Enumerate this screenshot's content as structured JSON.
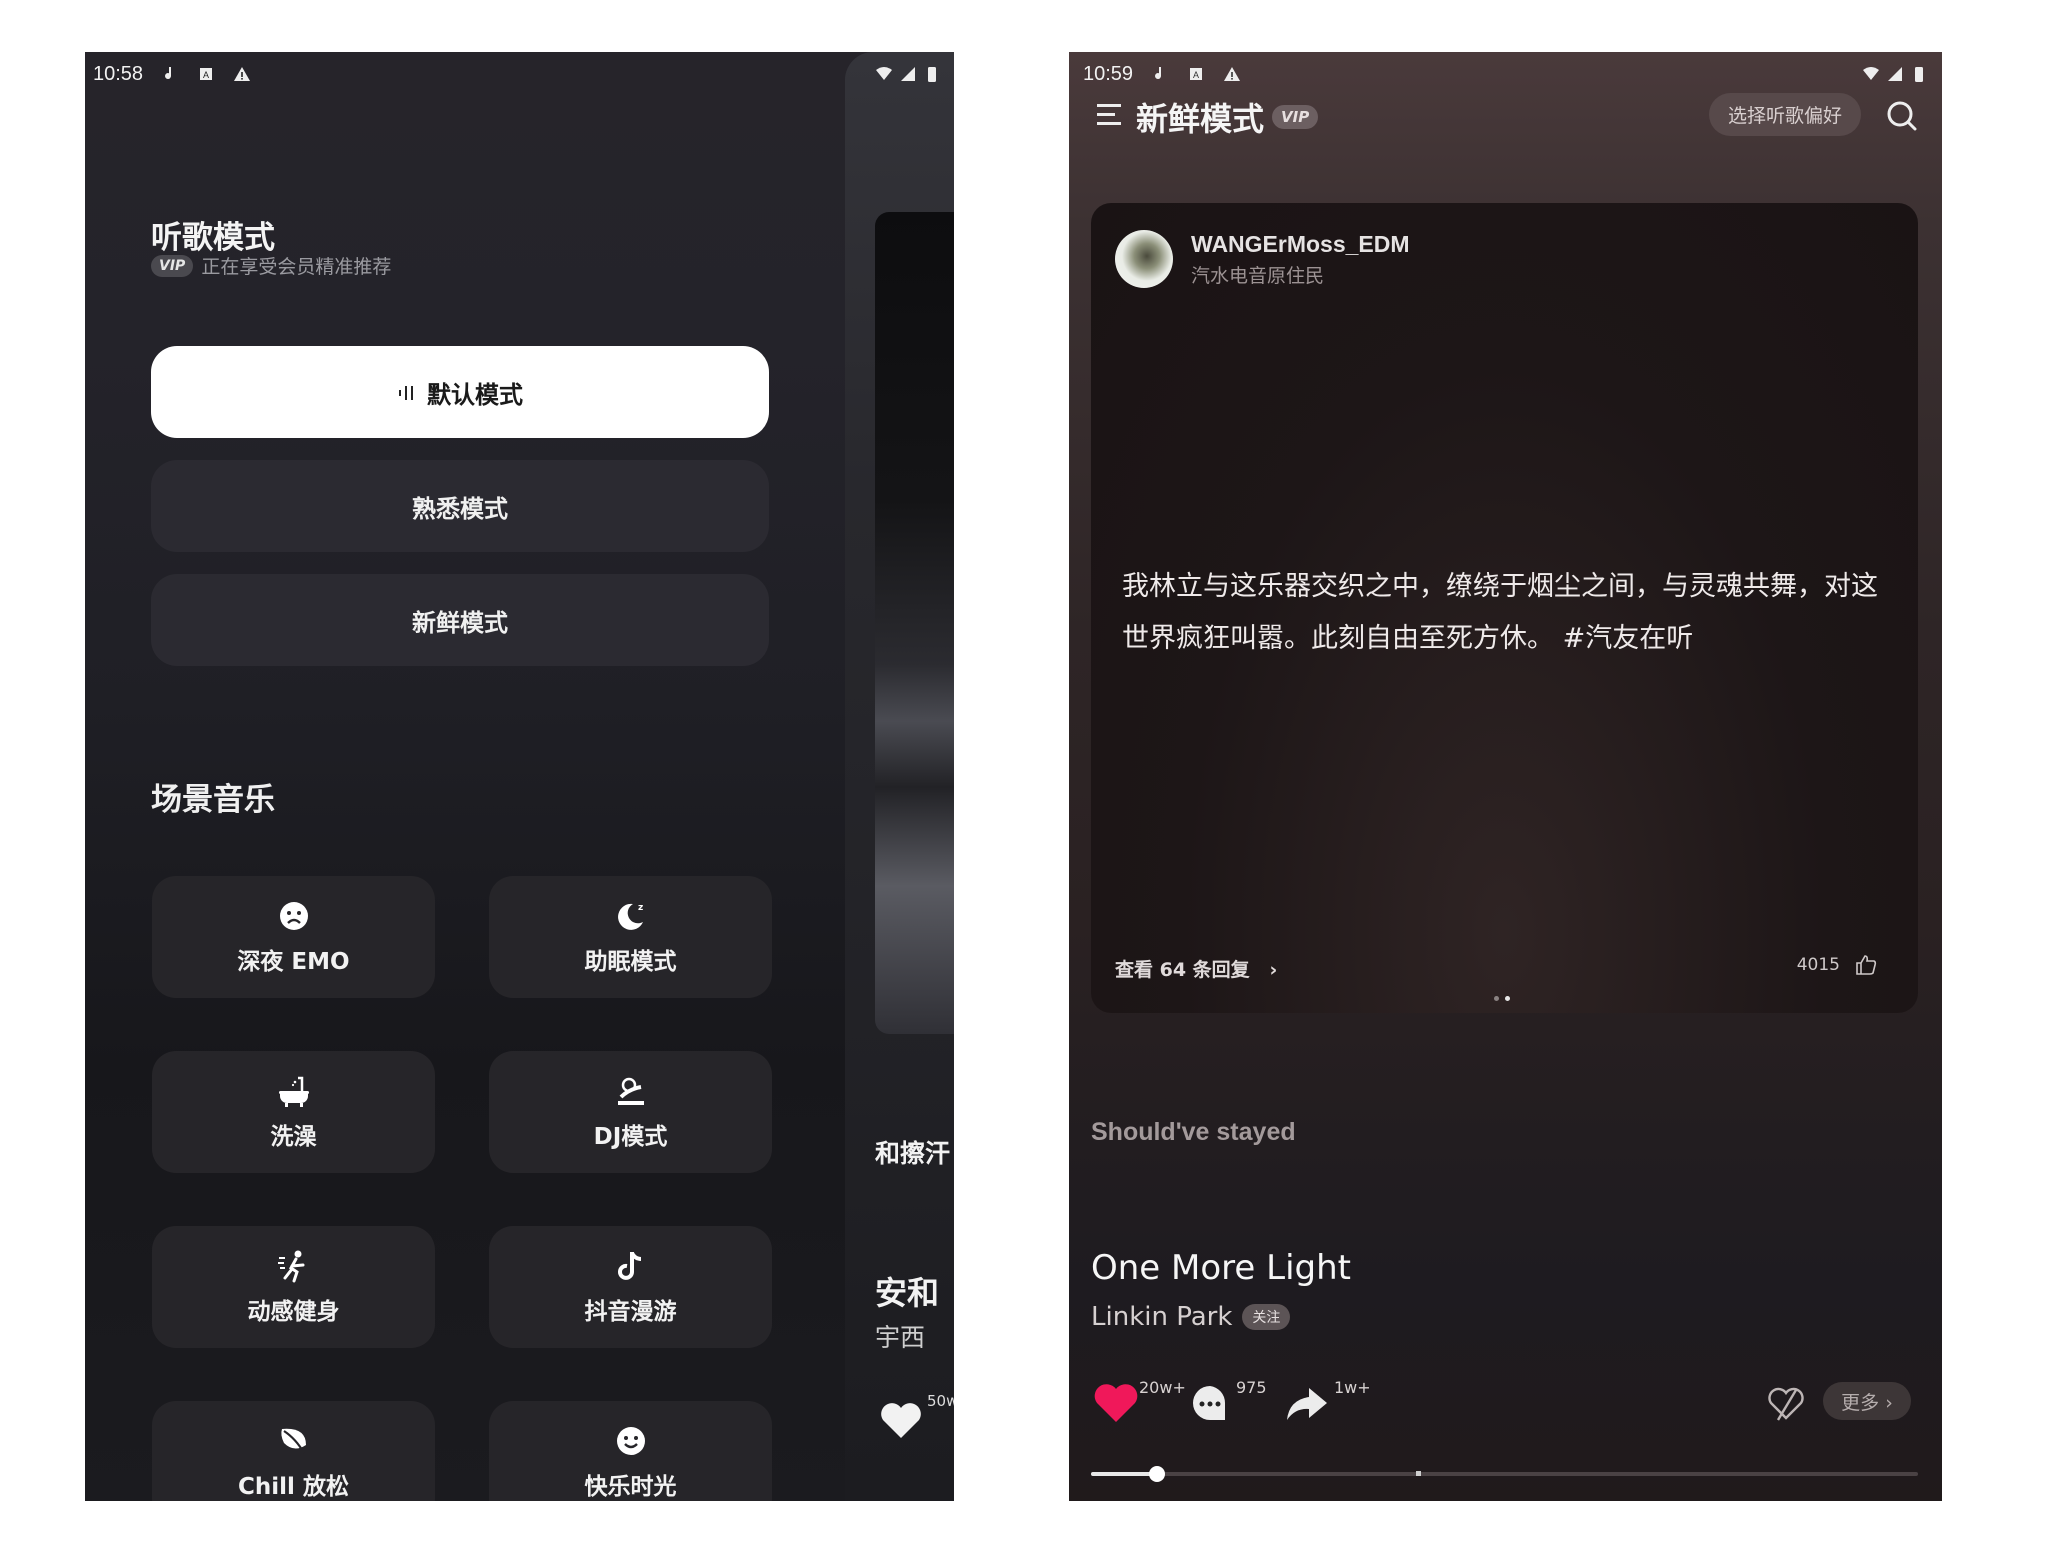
{
  "left_screen": {
    "status_bar": {
      "time": "10:58",
      "icons": [
        "music-note-icon",
        "a-box-icon",
        "warning-icon"
      ],
      "right_icons": [
        "wifi-icon",
        "signal-icon",
        "battery-icon"
      ]
    },
    "drawer": {
      "title": "听歌模式",
      "vip_badge": "VIP",
      "subtitle": "正在享受会员精准推荐",
      "modes": [
        {
          "label": "默认模式",
          "active": true,
          "icon": "equalizer-icon"
        },
        {
          "label": "熟悉模式",
          "active": false
        },
        {
          "label": "新鲜模式",
          "active": false
        }
      ],
      "scene_section_title": "场景音乐",
      "scenes": [
        {
          "label": "深夜 EMO",
          "icon": "sad-face-icon"
        },
        {
          "label": "助眠模式",
          "icon": "moon-sleep-icon"
        },
        {
          "label": "洗澡",
          "icon": "bathtub-icon"
        },
        {
          "label": "DJ模式",
          "icon": "dj-icon"
        },
        {
          "label": "动感健身",
          "icon": "running-icon"
        },
        {
          "label": "抖音漫游",
          "icon": "tiktok-note-icon"
        },
        {
          "label": "Chill 放松",
          "icon": "leaf-icon"
        },
        {
          "label": "快乐时光",
          "icon": "happy-face-icon"
        }
      ]
    },
    "peek_panel": {
      "lyric_fragment": "和擦汗",
      "song_fragment": "安和",
      "artist_fragment": "宇西",
      "like_count_fragment": "50w"
    }
  },
  "right_screen": {
    "status_bar": {
      "time": "10:59",
      "icons": [
        "music-note-icon",
        "a-box-icon",
        "warning-icon"
      ],
      "right_icons": [
        "wifi-icon",
        "signal-icon",
        "battery-icon"
      ]
    },
    "header": {
      "title": "新鲜模式",
      "vip_badge": "VIP",
      "preference_button": "选择听歌偏好"
    },
    "comment_card": {
      "author": "WANGErMoss_EDM",
      "author_subtitle": "汽水电音原住民",
      "text": "我林立与这乐器交织之中，缭绕于烟尘之间，与灵魂共舞，对这世界疯狂叫嚣。此刻自由至死方休。 #汽友在听",
      "view_replies": "查看 64 条回复",
      "like_count": "4015",
      "page_count": 2,
      "active_page": 2
    },
    "lyric_line": "Should've stayed",
    "song": {
      "title": "One More Light",
      "artist": "Linkin Park",
      "follow_label": "关注"
    },
    "actions": {
      "like_count": "20w+",
      "comment_count": "975",
      "share_count": "1w+",
      "more_label": "更多 ›"
    },
    "progress": {
      "played_fraction": 0.08,
      "marker_fraction": 0.395
    },
    "colors": {
      "like_red": "#f0185a"
    }
  }
}
